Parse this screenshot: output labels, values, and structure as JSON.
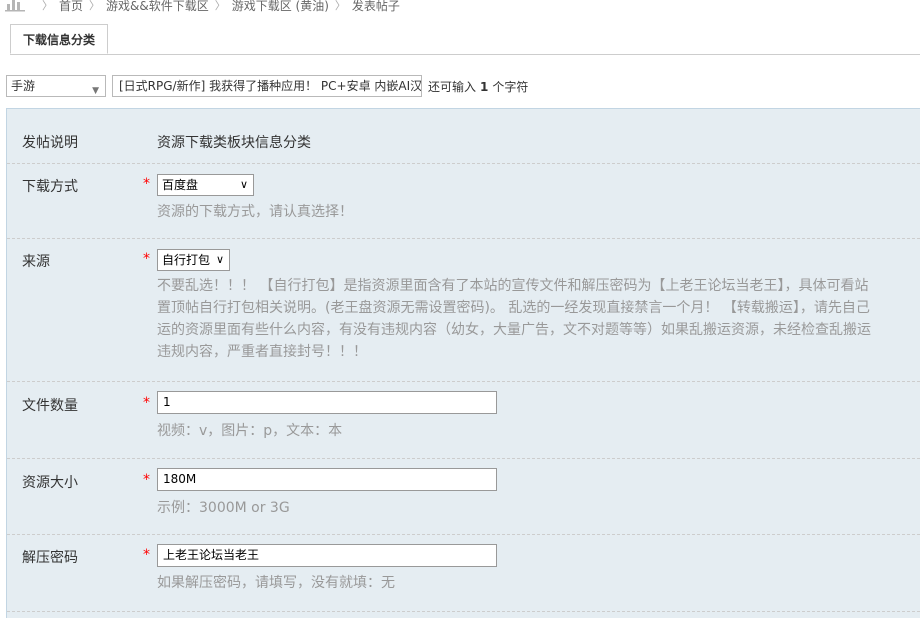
{
  "breadcrumb": {
    "items": [
      "首页",
      "游戏&&软件下载区",
      "游戏下载区 (黄油)",
      "发表帖子"
    ]
  },
  "tab": {
    "label": "下载信息分类"
  },
  "title_bar": {
    "type_select": "手游",
    "subject": "[日式RPG/新作] 我获得了播种应用！ PC+安卓 内嵌AI汉",
    "hint_prefix": "还可输入",
    "hint_count": "1",
    "hint_suffix": "个字符"
  },
  "form": {
    "intro": {
      "label": "发帖说明",
      "value": "资源下载类板块信息分类"
    },
    "download_method": {
      "label": "下载方式",
      "required": "*",
      "value": "百度盘",
      "desc": "资源的下载方式，请认真选择！"
    },
    "source": {
      "label": "来源",
      "required": "*",
      "value": "自行打包",
      "desc_lines": [
        "不要乱选！！！ 【自行打包】是指资源里面含有了本站的宣传文件和解压密码为【上老王论坛当老王】，具体可看站",
        "置顶帖自行打包相关说明。(老王盘资源无需设置密码)。 乱选的一经发现直接禁言一个月！ 【转载搬运】，请先自己",
        "运的资源里面有些什么内容，有没有违规内容（幼女，大量广告，文不对题等等）如果乱搬运资源，未经检查乱搬运",
        "违规内容，严重者直接封号！！！"
      ]
    },
    "file_count": {
      "label": "文件数量",
      "required": "*",
      "value": "1",
      "desc": "视频：v，图片：p，文本：本"
    },
    "size": {
      "label": "资源大小",
      "required": "*",
      "value": "180M",
      "desc": "示例：3000M or 3G"
    },
    "password": {
      "label": "解压密码",
      "required": "*",
      "value": "上老王论坛当老王",
      "desc": "如果解压密码，请填写，没有就填：无"
    }
  }
}
